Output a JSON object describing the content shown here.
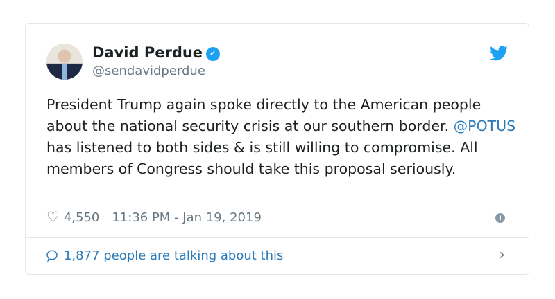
{
  "author": {
    "name": "David Perdue",
    "handle": "@sendavidperdue",
    "verified": true
  },
  "tweet": {
    "text_before": "President Trump again spoke directly to the American people about the national security crisis at our southern border. ",
    "mention": "@POTUS",
    "text_after": " has listened to both sides & is still willing to compromise. All members of Congress should take this proposal seriously."
  },
  "meta": {
    "likes": "4,550",
    "timestamp": "11:36 PM - Jan 19, 2019"
  },
  "footer": {
    "talking": "1,877 people are talking about this"
  },
  "colors": {
    "accent": "#2b7bb9",
    "verified": "#1da1f2",
    "text": "#1c2022",
    "muted": "#697882"
  },
  "icons": [
    "heart-icon",
    "info-icon",
    "comment-bubble-icon",
    "chevron-right-icon",
    "twitter-bird-icon",
    "verified-badge-icon"
  ]
}
